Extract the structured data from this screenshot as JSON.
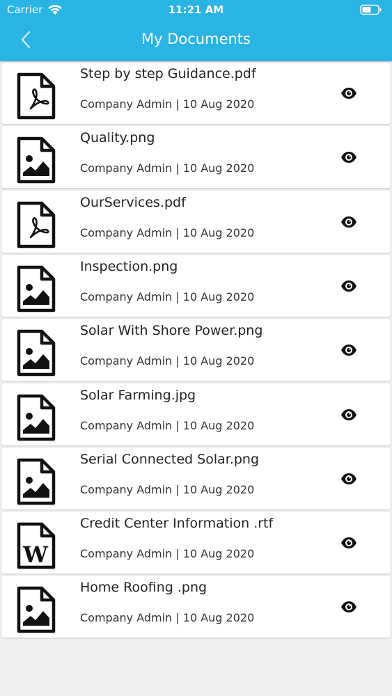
{
  "status_bar": {
    "carrier": "Carrier",
    "time": "11:21 AM"
  },
  "header": {
    "title": "My Documents",
    "accent_color": "#29b4e3"
  },
  "documents": [
    {
      "name": "Step by step Guidance.pdf",
      "meta": "Company Admin | 10 Aug 2020",
      "icon": "pdf-file-icon"
    },
    {
      "name": "Quality.png",
      "meta": "Company Admin | 10 Aug 2020",
      "icon": "image-file-icon"
    },
    {
      "name": "OurServices.pdf",
      "meta": "Company Admin | 10 Aug 2020",
      "icon": "pdf-file-icon"
    },
    {
      "name": "Inspection.png",
      "meta": "Company Admin | 10 Aug 2020",
      "icon": "image-file-icon"
    },
    {
      "name": "Solar With Shore Power.png",
      "meta": "Company Admin | 10 Aug 2020",
      "icon": "image-file-icon"
    },
    {
      "name": "Solar Farming.jpg",
      "meta": "Company Admin | 10 Aug 2020",
      "icon": "image-file-icon"
    },
    {
      "name": "Serial Connected Solar.png",
      "meta": "Company Admin | 10 Aug 2020",
      "icon": "image-file-icon"
    },
    {
      "name": "Credit Center Information .rtf",
      "meta": "Company Admin | 10 Aug 2020",
      "icon": "word-file-icon"
    },
    {
      "name": "Home Roofing .png",
      "meta": "Company Admin | 10 Aug 2020",
      "icon": "image-file-icon"
    }
  ]
}
